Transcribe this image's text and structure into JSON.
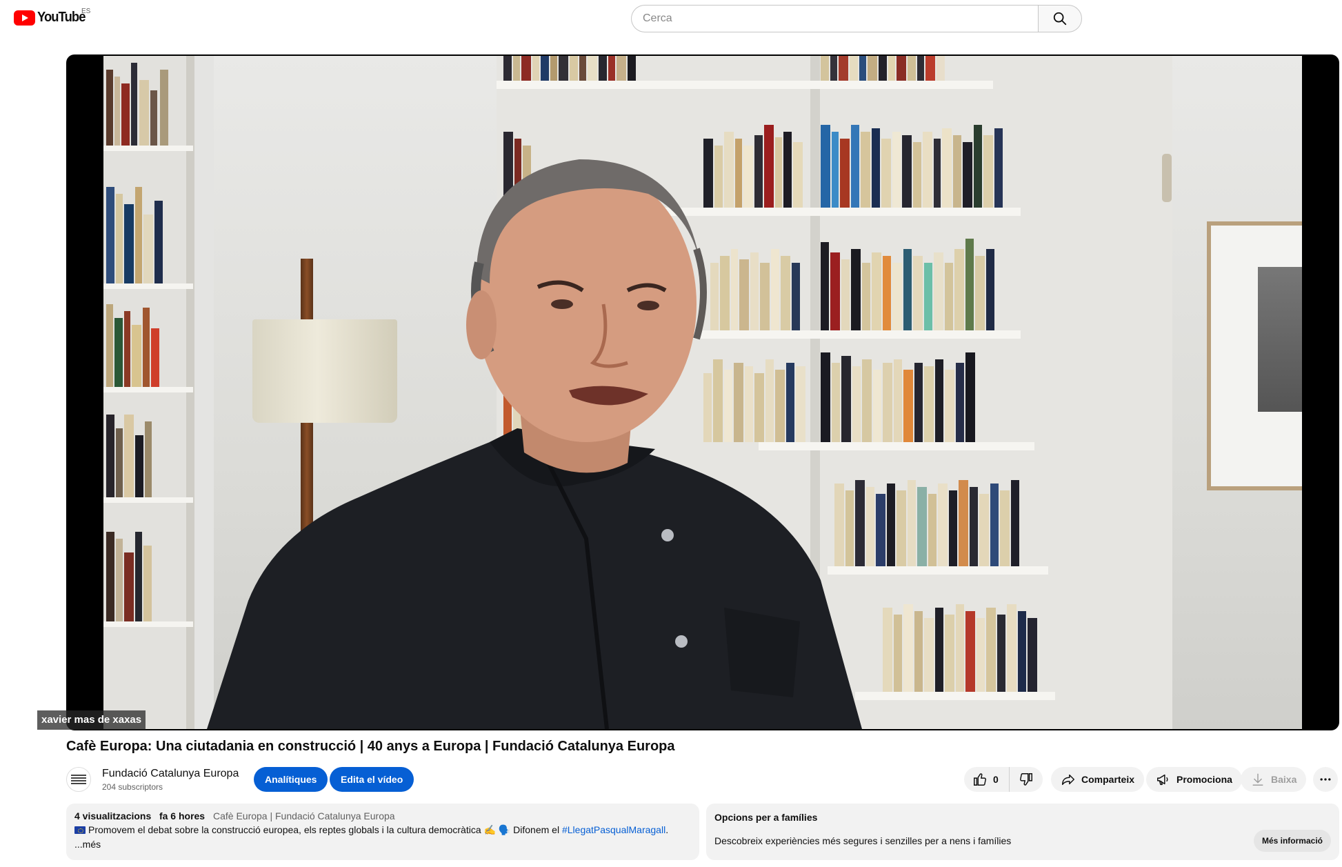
{
  "header": {
    "logo_text": "YouTube",
    "country_code": "ES",
    "search_placeholder": "Cerca"
  },
  "player": {
    "participant_name": "xavier mas de xaxas"
  },
  "video": {
    "title": "Cafè Europa: Una ciutadania en construcció | 40 anys a Europa | Fundació Catalunya Europa"
  },
  "channel": {
    "name": "Fundació Catalunya Europa",
    "subscribers": "204 subscriptors"
  },
  "buttons": {
    "analytics": "Analítiques",
    "edit": "Edita el vídeo",
    "like_count": "0",
    "share": "Comparteix",
    "promote": "Promociona",
    "download": "Baixa"
  },
  "description": {
    "views": "4 visualitzacions",
    "age": "fa 6 hores",
    "channel_tag": "Cafè Europa | Fundació Catalunya Europa",
    "text": "Promovem el debat sobre la construcció europea, els reptes globals i la cultura democràtica ✍️ 🗣️ Difonem el ",
    "hashtag": "#LlegatPasqualMaragall",
    "text_end": ".",
    "more": "...més"
  },
  "family": {
    "title": "Opcions per a famílies",
    "text": "Descobreix experiències més segures i senzilles per a nens i famílies",
    "button": "Més informació"
  },
  "colors": {
    "brand_red": "#ff0000",
    "accent_blue": "#065fd4",
    "chip_bg": "#f2f2f2"
  }
}
